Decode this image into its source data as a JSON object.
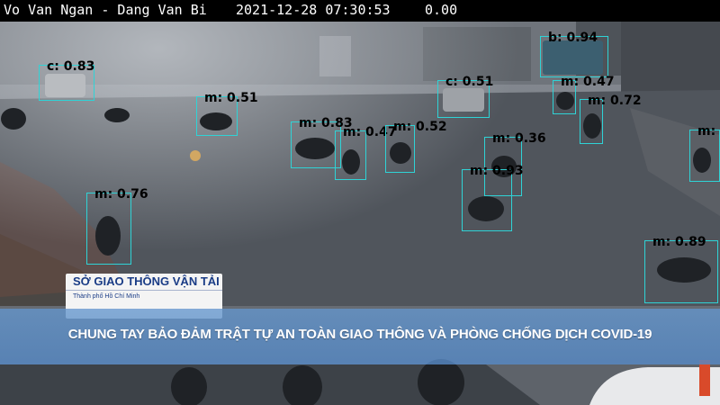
{
  "camera": {
    "location": "Vo Van Ngan - Dang Van Bi",
    "datetime": "2021-12-28 07:30:53",
    "value": "0.00"
  },
  "detections": [
    {
      "label": "c: 0.83"
    },
    {
      "label": "m: 0.51"
    },
    {
      "label": "c: 0.51"
    },
    {
      "label": "b: 0.94"
    },
    {
      "label": "m: 0.47"
    },
    {
      "label": "m: 0.72"
    },
    {
      "label": "m: 0.83"
    },
    {
      "label": "m: 0.47"
    },
    {
      "label": "m: 0.52"
    },
    {
      "label": "m: 0.36"
    },
    {
      "label": "m: 0.93"
    },
    {
      "label": "m: 0.76"
    },
    {
      "label": "m: 0.89"
    },
    {
      "label": "m:"
    }
  ],
  "logo": {
    "title": "SỞ GIAO THÔNG VẬN TẢI",
    "subtitle": "Thành phố Hồ Chí Minh"
  },
  "banner": {
    "text": "CHUNG TAY BẢO ĐẢM TRẬT TỰ AN TOÀN GIAO THÔNG VÀ PHÒNG CHỐNG DỊCH COVID-19"
  },
  "colors": {
    "box": "#2fd3d6",
    "banner": "#5f8fcc",
    "logo_text": "#1a3c86"
  }
}
